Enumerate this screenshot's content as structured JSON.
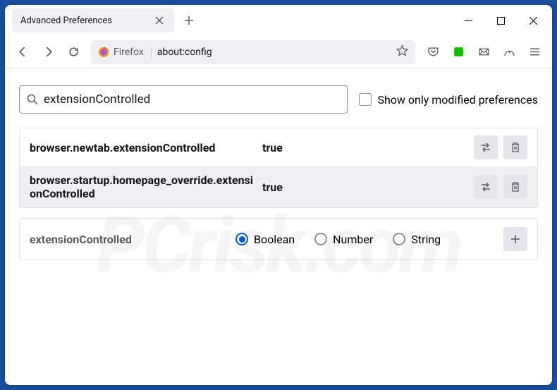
{
  "titlebar": {
    "tab_title": "Advanced Preferences"
  },
  "toolbar": {
    "identity_label": "Firefox",
    "url": "about:config"
  },
  "search": {
    "value": "extensionControlled",
    "checkbox_label": "Show only modified preferences"
  },
  "prefs": [
    {
      "name": "browser.newtab.extensionControlled",
      "value": "true"
    },
    {
      "name": "browser.startup.homepage_override.extensionControlled",
      "value": "true"
    }
  ],
  "new_pref": {
    "name": "extensionControlled",
    "types": [
      "Boolean",
      "Number",
      "String"
    ],
    "selected": "Boolean"
  },
  "watermark": "PCrisk.com"
}
